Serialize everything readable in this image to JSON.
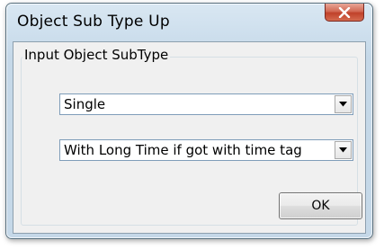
{
  "window": {
    "title": "Object Sub Type Up",
    "close_icon": "close-x-icon"
  },
  "group": {
    "label": "Input Object SubType"
  },
  "subtype_combo": {
    "value": "Single",
    "arrow_icon": "dropdown-arrow-icon"
  },
  "time_combo": {
    "value": "With Long Time if got with time tag",
    "arrow_icon": "dropdown-arrow-icon"
  },
  "buttons": {
    "ok_label": "OK"
  },
  "colors": {
    "close_button": "#c8472f",
    "client_background": "#f0f0f0",
    "combo_border": "#7f9db9"
  }
}
